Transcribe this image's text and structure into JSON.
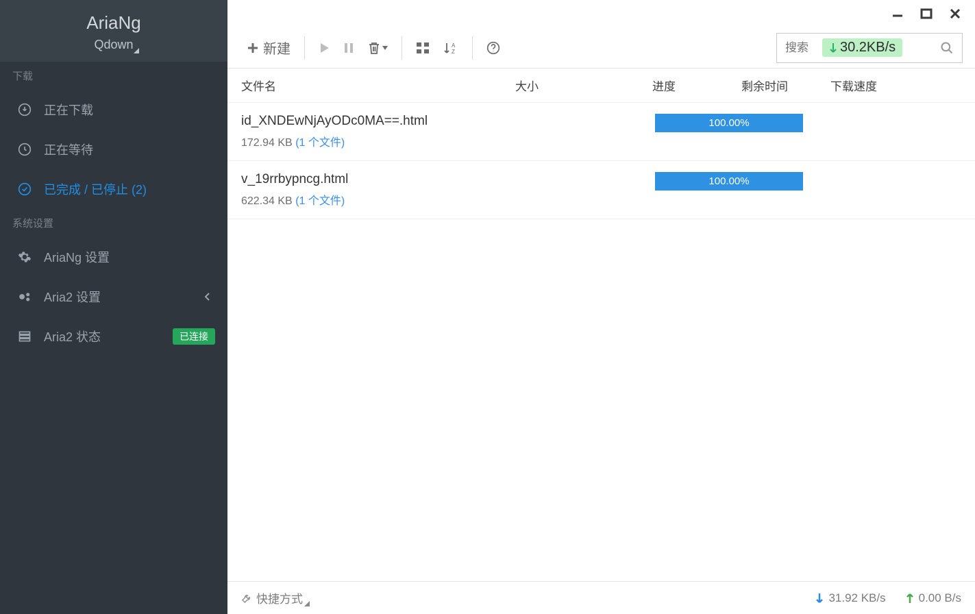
{
  "brand": {
    "title": "AriaNg",
    "subtitle": "Qdown"
  },
  "sidebar": {
    "sections": {
      "downloads": "下载",
      "system": "系统设置"
    },
    "items": {
      "downloading": "正在下载",
      "waiting": "正在等待",
      "finished": "已完成 / 已停止 (2)",
      "ariang_settings": "AriaNg 设置",
      "aria2_settings": "Aria2 设置",
      "aria2_status": "Aria2 状态"
    },
    "status_badge": "已连接"
  },
  "toolbar": {
    "new_label": "新建",
    "search_placeholder": "搜索",
    "overlay_speed": "30.2KB/s"
  },
  "columns": {
    "name": "文件名",
    "size": "大小",
    "progress": "进度",
    "remaining": "剩余时间",
    "speed": "下载速度"
  },
  "tasks": [
    {
      "name": "id_XNDEwNjAyODc0MA==.html",
      "size": "172.94 KB",
      "file_count": "(1 个文件)",
      "progress": "100.00%"
    },
    {
      "name": "v_19rrbypncg.html",
      "size": "622.34 KB",
      "file_count": "(1 个文件)",
      "progress": "100.00%"
    }
  ],
  "footer": {
    "shortcut": "快捷方式",
    "download_speed": "31.92 KB/s",
    "upload_speed": "0.00 B/s"
  }
}
